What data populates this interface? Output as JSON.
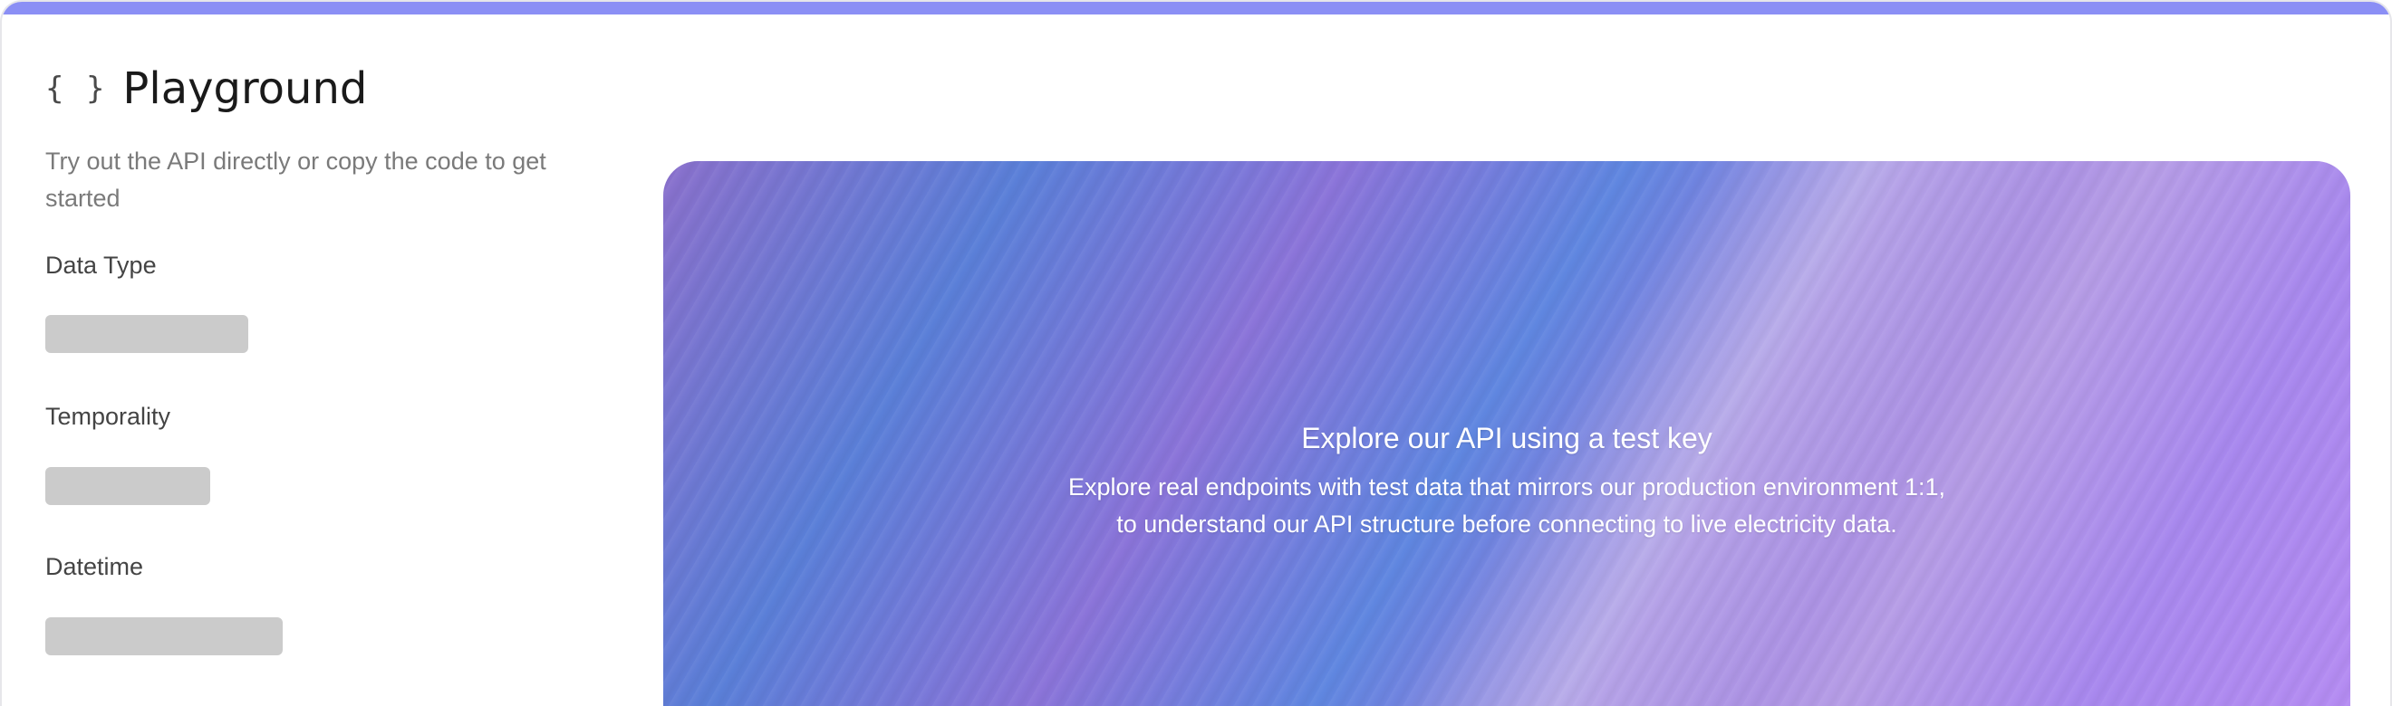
{
  "header": {
    "icon": "braces-icon",
    "icon_glyph": "{ }",
    "title": "Playground"
  },
  "subtitle": "Try out the API directly or copy the code to get started",
  "fields": [
    {
      "label": "Data Type"
    },
    {
      "label": "Temporality"
    },
    {
      "label": "Datetime"
    }
  ],
  "hero": {
    "title": "Explore our API using a test key",
    "description_line1": "Explore real endpoints with test data that mirrors our production environment 1:1,",
    "description_line2": "to understand our API structure before connecting to live electricity data."
  },
  "colors": {
    "accent": "#8b8ff5",
    "skeleton": "#cbcbcb"
  }
}
